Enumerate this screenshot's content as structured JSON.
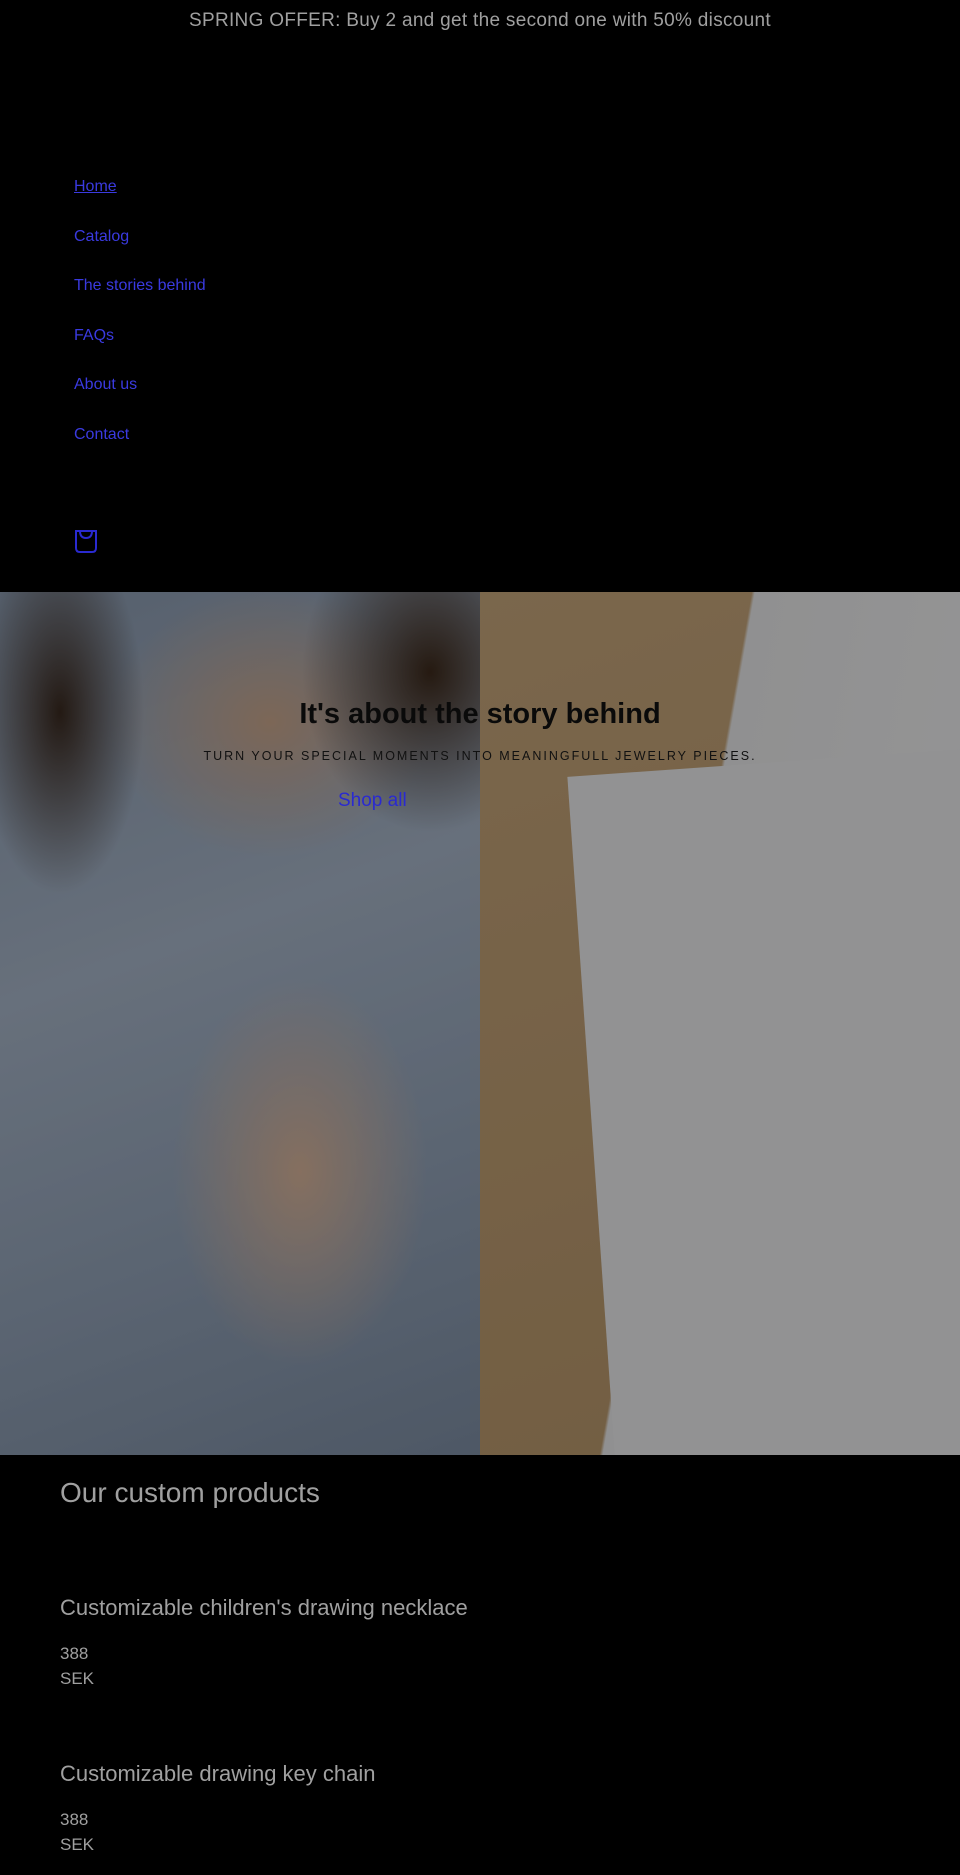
{
  "announcement": "SPRING OFFER: Buy 2 and get the second one with 50% discount",
  "nav": {
    "items": [
      {
        "label": "Home"
      },
      {
        "label": "Catalog"
      },
      {
        "label": "The stories behind"
      },
      {
        "label": "FAQs"
      },
      {
        "label": "About us"
      },
      {
        "label": "Contact"
      }
    ],
    "cart_icon": "shopping-bag-icon"
  },
  "hero": {
    "title": "It's about the story behind",
    "subtitle": "TURN YOUR SPECIAL MOMENTS INTO MEANINGFULL JEWELRY PIECES.",
    "cta": "Shop all"
  },
  "products": {
    "title": "Our custom products",
    "items": [
      {
        "name": "Customizable children's drawing necklace",
        "price": "388",
        "currency": "SEK"
      },
      {
        "name": "Customizable drawing key chain",
        "price": "388",
        "currency": "SEK"
      }
    ]
  },
  "colors": {
    "background": "#000000",
    "link": "#2a2ad0",
    "text": "#9a9a9a"
  }
}
